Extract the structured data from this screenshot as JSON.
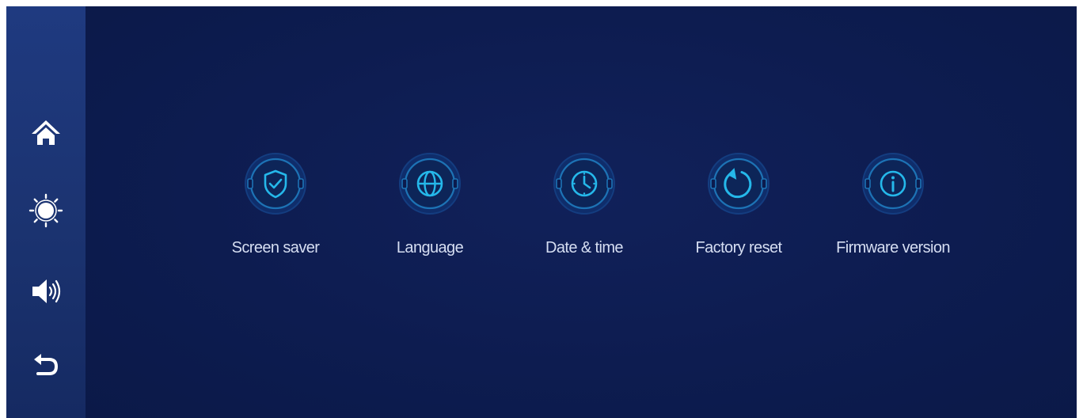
{
  "sidebar": {
    "items": [
      {
        "icon": "home-icon"
      },
      {
        "icon": "brightness-icon"
      },
      {
        "icon": "volume-icon"
      },
      {
        "icon": "back-icon"
      }
    ]
  },
  "settings": {
    "items": [
      {
        "label": "Screen saver",
        "icon": "shield-check-icon"
      },
      {
        "label": "Language",
        "icon": "globe-icon"
      },
      {
        "label": "Date & time",
        "icon": "clock-icon"
      },
      {
        "label": "Factory reset",
        "icon": "reset-icon"
      },
      {
        "label": "Firmware version",
        "icon": "info-icon"
      }
    ]
  },
  "colors": {
    "background": "#0c1b4d",
    "sidebar": "#1d3675",
    "accent": "#25b8ea",
    "label": "#d6def2"
  }
}
